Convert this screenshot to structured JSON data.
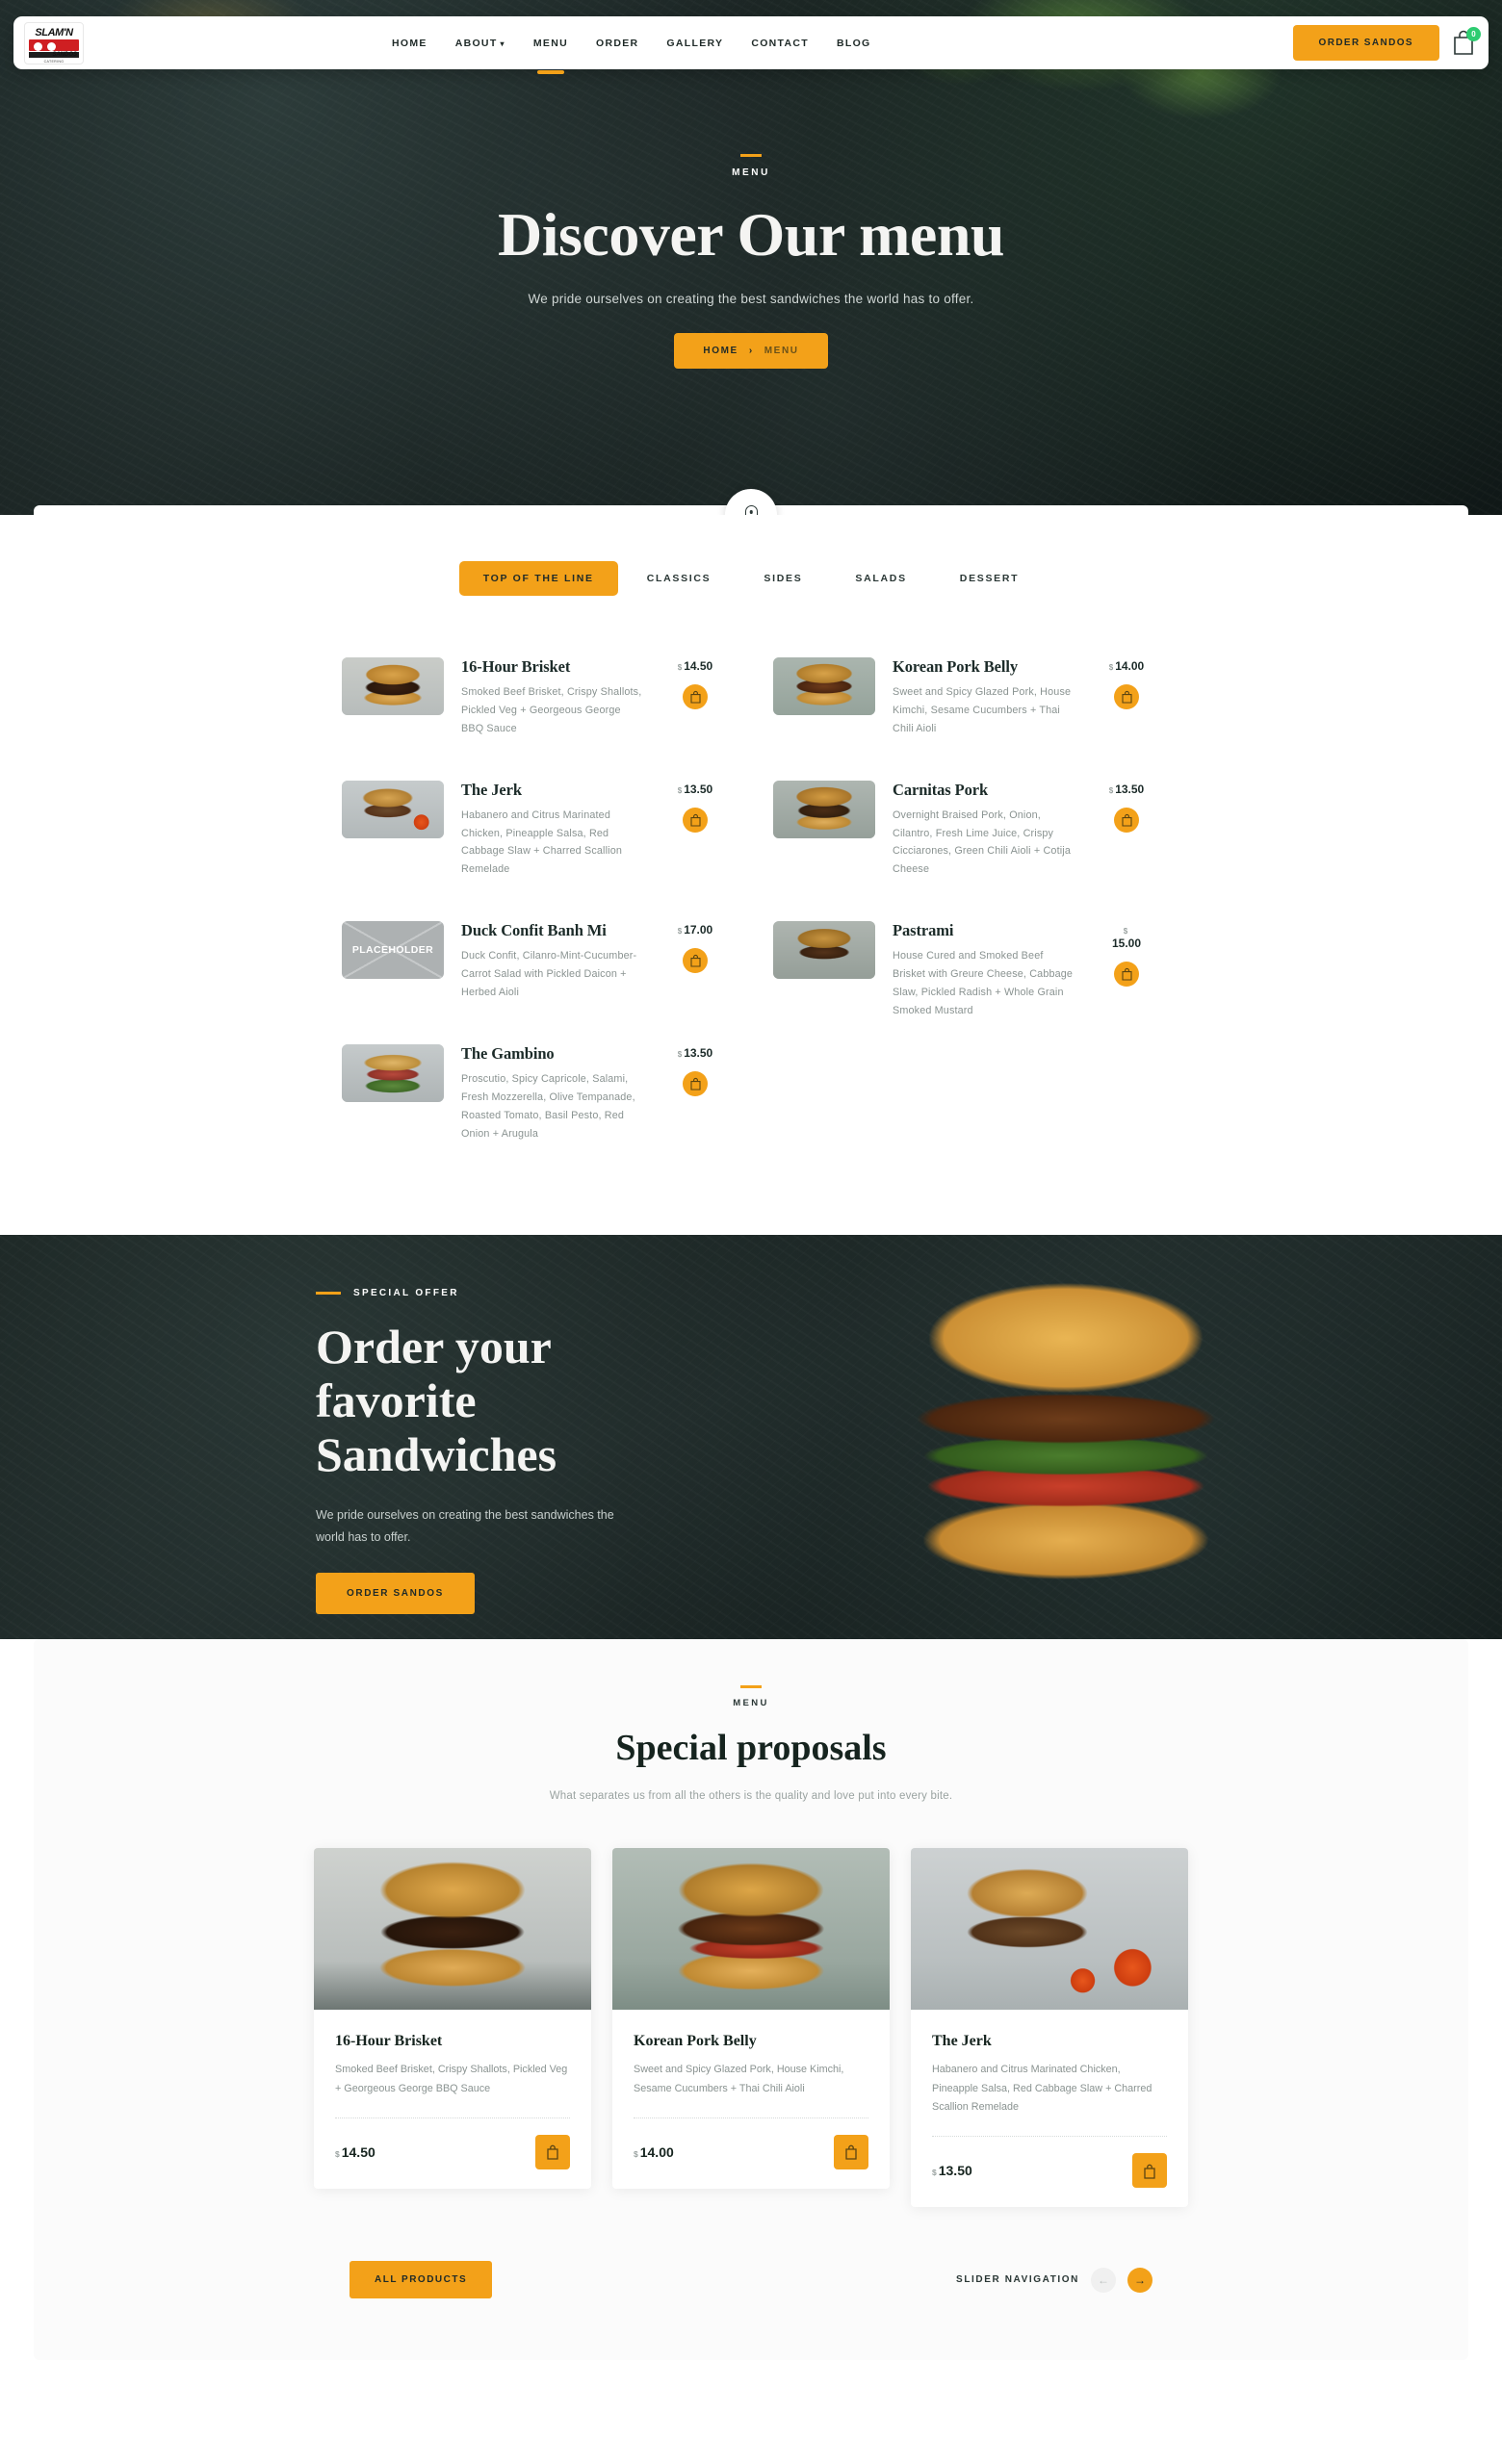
{
  "nav": {
    "logo": {
      "line1": "SLAM'N",
      "line2": "SANDOS",
      "caption": "CATERING"
    },
    "links": [
      {
        "label": "HOME",
        "active": false,
        "has_caret": false
      },
      {
        "label": "ABOUT",
        "active": false,
        "has_caret": true
      },
      {
        "label": "MENU",
        "active": true,
        "has_caret": false
      },
      {
        "label": "ORDER",
        "active": false,
        "has_caret": false
      },
      {
        "label": "GALLERY",
        "active": false,
        "has_caret": false
      },
      {
        "label": "CONTACT",
        "active": false,
        "has_caret": false
      },
      {
        "label": "BLOG",
        "active": false,
        "has_caret": false
      }
    ],
    "order_button": "ORDER SANDOS",
    "cart_count": "0"
  },
  "hero": {
    "eyebrow": "MENU",
    "title": "Discover Our menu",
    "subtitle": "We pride ourselves on creating the best sandwiches the world has to offer.",
    "breadcrumb_home": "HOME",
    "breadcrumb_sep": "›",
    "breadcrumb_current": "MENU"
  },
  "menu": {
    "tabs": [
      {
        "label": "TOP OF THE LINE",
        "active": true
      },
      {
        "label": "CLASSICS",
        "active": false
      },
      {
        "label": "SIDES",
        "active": false
      },
      {
        "label": "SALADS",
        "active": false
      },
      {
        "label": "DESSERT",
        "active": false
      }
    ],
    "currency": "$",
    "left_items": [
      {
        "name": "16-Hour Brisket",
        "desc": "Smoked Beef Brisket, Crispy Shallots, Pickled Veg + Georgeous George BBQ Sauce",
        "price": "14.50",
        "thumb": "f1"
      },
      {
        "name": "The Jerk",
        "desc": "Habanero and Citrus Marinated Chicken, Pineapple Salsa, Red Cabbage Slaw + Charred Scallion Remelade",
        "price": "13.50",
        "thumb": "f3"
      },
      {
        "name": "Duck Confit Banh Mi",
        "desc": "Duck Confit, Cilanro-Mint-Cucumber-Carrot Salad with Pickled Daicon + Herbed Aioli",
        "price": "17.00",
        "thumb": "placeholder",
        "placeholder_label": "PLACEHOLDER"
      },
      {
        "name": "The Gambino",
        "desc": "Proscutio, Spicy Capricole, Salami, Fresh Mozzerella, Olive Tempanade, Roasted Tomato, Basil Pesto, Red Onion + Arugula",
        "price": "13.50",
        "thumb": "f6"
      }
    ],
    "right_items": [
      {
        "name": "Korean Pork Belly",
        "desc": "Sweet and Spicy Glazed Pork, House Kimchi, Sesame Cucumbers + Thai Chili Aioli",
        "price": "14.00",
        "thumb": "f2"
      },
      {
        "name": "Carnitas Pork",
        "desc": "Overnight Braised Pork, Onion, Cilantro, Fresh Lime Juice, Crispy Cicciarones, Green Chili Aioli + Cotija Cheese",
        "price": "13.50",
        "thumb": "f4"
      },
      {
        "name": "Pastrami",
        "desc": "House Cured and Smoked Beef Brisket with Greure Cheese, Cabbage Slaw, Pickled Radish + Whole Grain Smoked Mustard",
        "price": "15.00",
        "thumb": "f5"
      }
    ]
  },
  "offer": {
    "eyebrow": "SPECIAL OFFER",
    "title_line1": "Order your",
    "title_line2": "favorite",
    "title_line3": "Sandwiches",
    "text": "We pride ourselves on creating the best sandwiches the world has to offer.",
    "button": "ORDER SANDOS"
  },
  "proposals": {
    "eyebrow": "MENU",
    "title": "Special proposals",
    "subtitle": "What separates us from all the others is the quality and love put into every bite.",
    "currency": "$",
    "cards": [
      {
        "name": "16-Hour Brisket",
        "desc": "Smoked Beef Brisket, Crispy Shallots, Pickled Veg + Georgeous George BBQ Sauce",
        "price": "14.50",
        "img": "c1"
      },
      {
        "name": "Korean Pork Belly",
        "desc": "Sweet and Spicy Glazed Pork, House Kimchi, Sesame Cucumbers + Thai Chili Aioli",
        "price": "14.00",
        "img": "c2"
      },
      {
        "name": "The Jerk",
        "desc": "Habanero and Citrus Marinated Chicken, Pineapple Salsa, Red Cabbage Slaw + Charred Scallion Remelade",
        "price": "13.50",
        "img": "c3"
      }
    ],
    "all_products_button": "ALL PRODUCTS",
    "slider_label": "SLIDER NAVIGATION",
    "prev_icon": "←",
    "next_icon": "→"
  },
  "colors": {
    "accent": "#f3a119",
    "dark": "#1b2423",
    "text_dark": "#16241f",
    "muted": "#8a9391",
    "badge_green": "#2ecc71"
  }
}
